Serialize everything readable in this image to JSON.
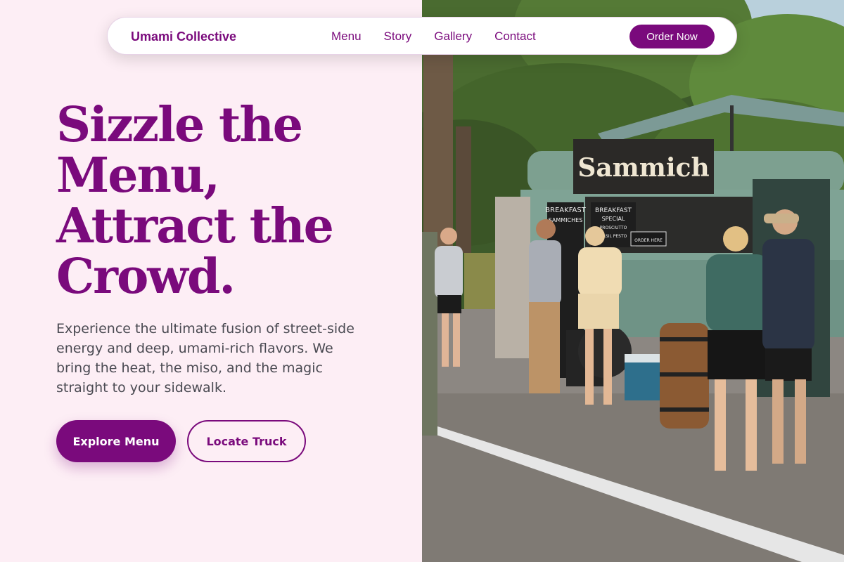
{
  "nav": {
    "brand": "Umami Collective",
    "links": [
      "Menu",
      "Story",
      "Gallery",
      "Contact"
    ],
    "cta": "Order Now"
  },
  "hero": {
    "headline": [
      "Sizzle the",
      "Menu,",
      "Attract the",
      "Crowd."
    ],
    "description": "Experience the ultimate fusion of street-side energy and deep, umami-rich flavors. We bring the heat, the miso, and the magic straight to your sidewalk.",
    "primary_button": "Explore Menu",
    "secondary_button": "Locate Truck"
  },
  "photo": {
    "truck_sign": "Sammich",
    "menu_board_1": [
      "BREAKFAST",
      "SAMMICHES"
    ],
    "menu_board_2": [
      "BREAKFAST",
      "SPECIAL",
      "PROSCIUTTO",
      "BASIL PESTO"
    ],
    "small_sign": "ORDER HERE"
  },
  "colors": {
    "brand_purple": "#7A0A7C",
    "page_background": "#FDEEF5",
    "body_text": "#4a4a52"
  }
}
